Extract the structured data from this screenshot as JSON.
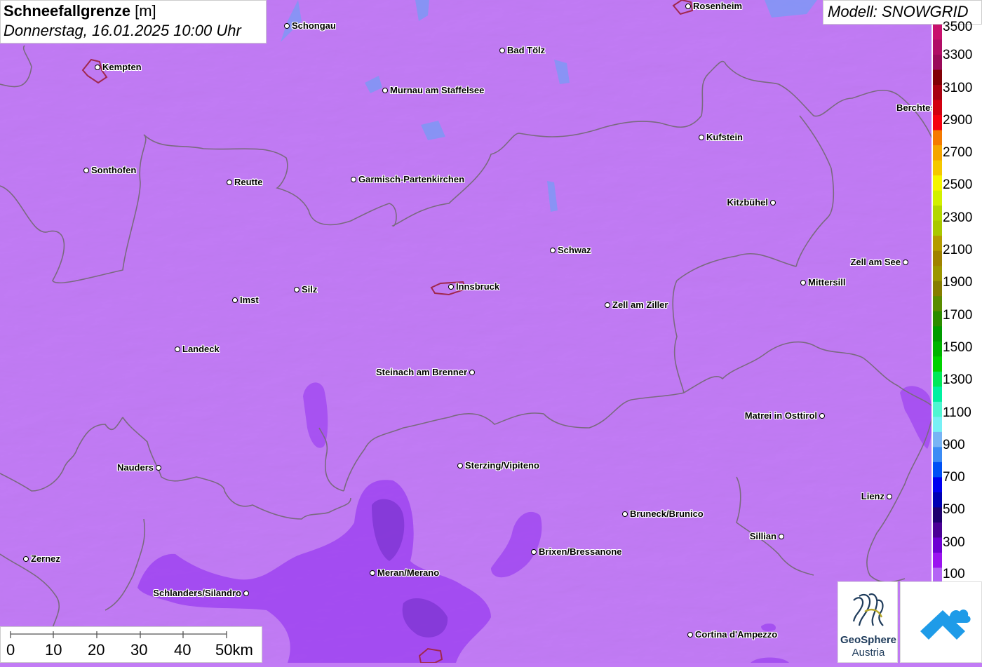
{
  "header": {
    "title": "Schneefallgrenze",
    "unit": "[m]",
    "datetime": "Donnerstag, 16.01.2025 10:00 Uhr",
    "model": "Modell: SNOWGRID"
  },
  "legend": {
    "labels": [
      "3500",
      "3300",
      "3100",
      "2900",
      "2700",
      "2500",
      "2300",
      "2100",
      "1900",
      "1700",
      "1500",
      "1300",
      "1100",
      "900",
      "700",
      "500",
      "300",
      "100"
    ],
    "colors": [
      "#c8106e",
      "#b00d66",
      "#9a0a5a",
      "#820006",
      "#a80010",
      "#d20010",
      "#f50010",
      "#f57a00",
      "#f5a500",
      "#f5c800",
      "#f5f500",
      "#d2f000",
      "#b4d700",
      "#aac800",
      "#b49b00",
      "#a08200",
      "#9c9600",
      "#877d00",
      "#5a8c00",
      "#2d8c00",
      "#009b00",
      "#00b400",
      "#00d200",
      "#00e85a",
      "#00f0a0",
      "#50f5d2",
      "#78f0f5",
      "#78b4f5",
      "#3c8cf5",
      "#0050f5",
      "#0000f0",
      "#0000b4",
      "#1e006e",
      "#4b0096",
      "#6e00d2",
      "#9b14f0",
      "#b464f5"
    ]
  },
  "cities": [
    {
      "name": "Rosenheim",
      "dot": "left"
    },
    {
      "name": "Schongau",
      "dot": "left"
    },
    {
      "name": "Kempten",
      "dot": "left"
    },
    {
      "name": "Bad Tölz",
      "dot": "left"
    },
    {
      "name": "Murnau am Staffelsee",
      "dot": "left"
    },
    {
      "name": "Berchtesgaden",
      "dot": "right"
    },
    {
      "name": "Kufstein",
      "dot": "left"
    },
    {
      "name": "Sonthofen",
      "dot": "left"
    },
    {
      "name": "Reutte",
      "dot": "left"
    },
    {
      "name": "Garmisch-Partenkirchen",
      "dot": "left"
    },
    {
      "name": "Kitzbühel",
      "dot": "right"
    },
    {
      "name": "Schwaz",
      "dot": "left"
    },
    {
      "name": "Zell am See",
      "dot": "right"
    },
    {
      "name": "Mittersill",
      "dot": "left"
    },
    {
      "name": "Innsbruck",
      "dot": "left"
    },
    {
      "name": "Silz",
      "dot": "left"
    },
    {
      "name": "Imst",
      "dot": "left"
    },
    {
      "name": "Zell am Ziller",
      "dot": "left"
    },
    {
      "name": "Landeck",
      "dot": "left"
    },
    {
      "name": "Steinach am Brenner",
      "dot": "right"
    },
    {
      "name": "Matrei in Osttirol",
      "dot": "right"
    },
    {
      "name": "Nauders",
      "dot": "right"
    },
    {
      "name": "Sterzing/Vipiteno",
      "dot": "left"
    },
    {
      "name": "Lienz",
      "dot": "right"
    },
    {
      "name": "Bruneck/Brunico",
      "dot": "left"
    },
    {
      "name": "Sillian",
      "dot": "right"
    },
    {
      "name": "Brixen/Bressanone",
      "dot": "left"
    },
    {
      "name": "Zernez",
      "dot": "left"
    },
    {
      "name": "Meran/Merano",
      "dot": "left"
    },
    {
      "name": "Schlanders/Silandro",
      "dot": "right"
    },
    {
      "name": "Cortina d'Ampezzo",
      "dot": "left"
    }
  ],
  "scale": {
    "labels": [
      "0",
      "10",
      "20",
      "30",
      "40",
      "50km"
    ]
  },
  "logos": {
    "geosphere_line1": "GeoSphere",
    "geosphere_line2": "Austria"
  },
  "colors": {
    "base_field": "#c27bf5",
    "low_field": "#9a3ef0",
    "lowest_field": "#6f2cc4",
    "border": "#7a6a80",
    "city_outline": "#a0284e",
    "lake": "#7a9af5"
  }
}
